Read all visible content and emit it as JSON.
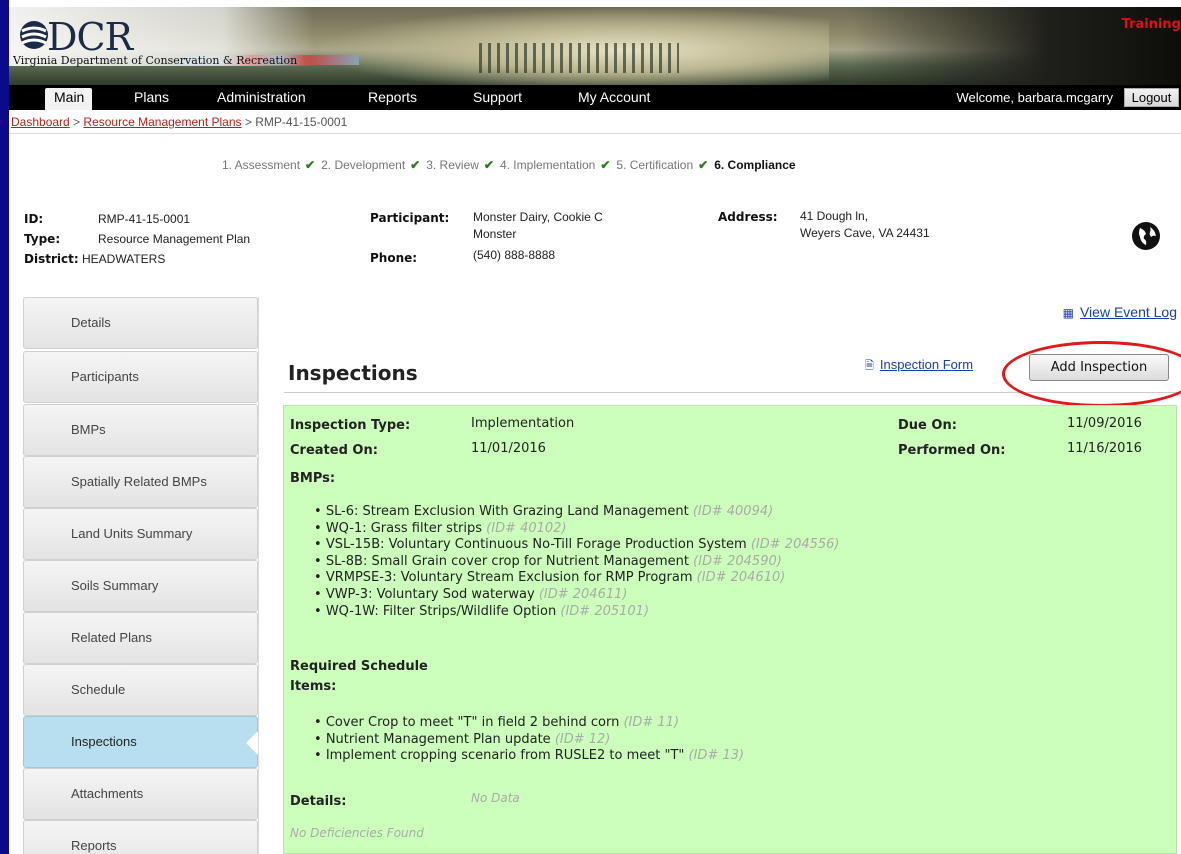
{
  "banner": {
    "logo_text": "DCR",
    "org_name": "Virginia Department of Conservation & Recreation",
    "environment": "Training"
  },
  "nav": {
    "tabs": [
      "Main",
      "Plans",
      "Administration",
      "Reports",
      "Support",
      "My Account"
    ],
    "active": "Main",
    "welcome": "Welcome, barbara.mcgarry",
    "logout": "Logout"
  },
  "breadcrumb": {
    "dashboard": "Dashboard",
    "sep1": ">",
    "rmp": "Resource Management Plans",
    "sep2": ">",
    "current": "RMP-41-15-0001"
  },
  "steps": [
    {
      "label": "1. Assessment",
      "done": true
    },
    {
      "label": "2. Development",
      "done": true
    },
    {
      "label": "3. Review",
      "done": true
    },
    {
      "label": "4. Implementation",
      "done": true
    },
    {
      "label": "5. Certification",
      "done": true
    },
    {
      "label": "6. Compliance",
      "done": false,
      "current": true
    }
  ],
  "plan": {
    "id_label": "ID:",
    "id": "RMP-41-15-0001",
    "type_label": "Type:",
    "type": "Resource Management Plan",
    "district_label": "District:",
    "district": "HEADWATERS",
    "participant_label": "Participant:",
    "participant_line1": "Monster Dairy, Cookie C",
    "participant_line2": "Monster",
    "phone_label": "Phone:",
    "phone": "(540) 888-8888",
    "address_label": "Address:",
    "address_line1": "41 Dough ln,",
    "address_line2": "Weyers Cave, VA 24431"
  },
  "sidebar": {
    "items": [
      "Details",
      "Participants",
      "BMPs",
      "Spatially Related BMPs",
      "Land Units Summary",
      "Soils Summary",
      "Related Plans",
      "Schedule",
      "Inspections",
      "Attachments",
      "Reports"
    ],
    "selected": "Inspections"
  },
  "main": {
    "view_event_log": "View Event Log",
    "title": "Inspections",
    "inspection_form": "Inspection Form",
    "add_inspection": "Add Inspection"
  },
  "inspection": {
    "type_label": "Inspection Type:",
    "type": "Implementation",
    "created_label": "Created On:",
    "created": "11/01/2016",
    "due_label": "Due On:",
    "due": "11/09/2016",
    "performed_label": "Performed On:",
    "performed": "11/16/2016",
    "bmps_label": "BMPs:",
    "bmps": [
      {
        "text": "SL-6: Stream Exclusion With Grazing Land Management",
        "id": "(ID# 40094)"
      },
      {
        "text": "WQ-1: Grass filter strips",
        "id": "(ID# 40102)"
      },
      {
        "text": "VSL-15B: Voluntary Continuous No-Till Forage Production System",
        "id": "(ID# 204556)"
      },
      {
        "text": "SL-8B: Small Grain cover crop for Nutrient Management",
        "id": "(ID# 204590)"
      },
      {
        "text": "VRMPSE-3: Voluntary Stream Exclusion for RMP Program",
        "id": "(ID# 204610)"
      },
      {
        "text": "VWP-3: Voluntary Sod waterway",
        "id": "(ID# 204611)"
      },
      {
        "text": "WQ-1W: Filter Strips/Wildlife Option",
        "id": "(ID# 205101)"
      }
    ],
    "schedule_label_1": "Required Schedule",
    "schedule_label_2": "Items:",
    "schedule_items": [
      {
        "text": "Cover Crop to meet \"T\" in field 2 behind corn",
        "id": "(ID# 11)"
      },
      {
        "text": "Nutrient Management Plan update",
        "id": "(ID# 12)"
      },
      {
        "text": "Implement cropping scenario from RUSLE2 to meet \"T\"",
        "id": "(ID# 13)"
      }
    ],
    "details_label": "Details:",
    "details": "No Data",
    "deficiencies": "No Deficiencies Found"
  },
  "colors": {
    "accent_link": "#1a3fb0",
    "breadcrumb_link": "#b3221d",
    "card_bg": "#ccffbb",
    "sidebar_selected": "#b7dff0",
    "highlight": "#e0191b"
  }
}
